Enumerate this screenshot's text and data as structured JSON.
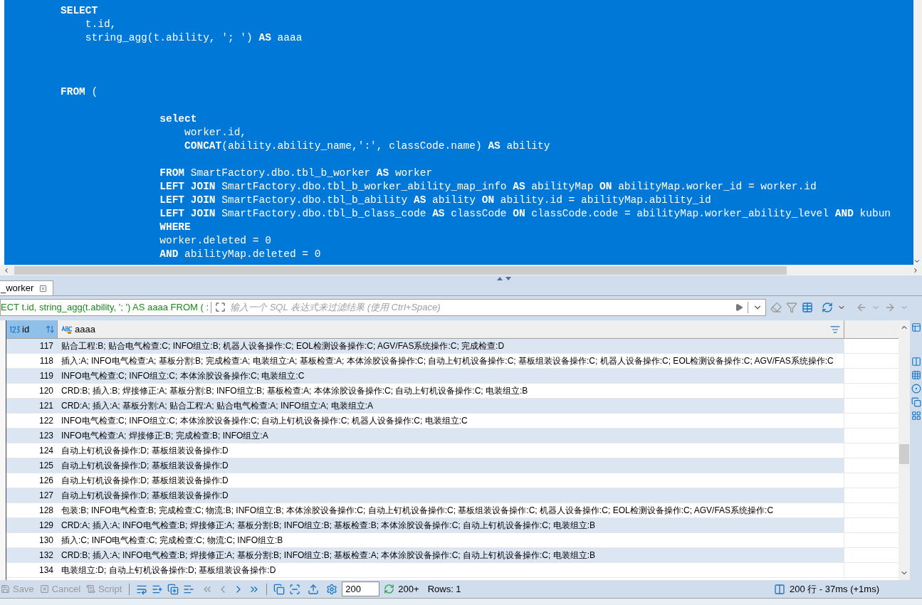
{
  "editor": {
    "lines": [
      {
        "kind": "code",
        "text": "**SELECT**"
      },
      {
        "kind": "code",
        "text": "    t.id,"
      },
      {
        "kind": "code",
        "text": "    string_agg(t.ability, '; ') **AS** aaaa"
      },
      {
        "kind": "blank"
      },
      {
        "kind": "blank"
      },
      {
        "kind": "blank"
      },
      {
        "kind": "code",
        "text": "**FROM** ("
      },
      {
        "kind": "blank"
      },
      {
        "kind": "code",
        "text": "                **select**"
      },
      {
        "kind": "code",
        "text": "                    worker.id,"
      },
      {
        "kind": "code",
        "text": "                    **CONCAT**(ability.ability_name,':', classCode.name) **AS** ability"
      },
      {
        "kind": "blank"
      },
      {
        "kind": "code",
        "text": "                **FROM** SmartFactory.dbo.tbl_b_worker **AS** worker"
      },
      {
        "kind": "code",
        "text": "                **LEFT JOIN** SmartFactory.dbo.tbl_b_worker_ability_map_info **AS** abilityMap **ON** abilityMap.worker_id = worker.id"
      },
      {
        "kind": "code",
        "text": "                **LEFT JOIN** SmartFactory.dbo.tbl_b_ability **AS** ability **ON** ability.id = abilityMap.ability_id"
      },
      {
        "kind": "code",
        "text": "                **LEFT JOIN** SmartFactory.dbo.tbl_b_class_code **AS** classCode **ON** classCode.code = abilityMap.worker_ability_level **AND** kubun"
      },
      {
        "kind": "code",
        "text": "                **WHERE**"
      },
      {
        "kind": "code",
        "text": "                worker.deleted = 0"
      },
      {
        "kind": "code",
        "text": "                **AND** abilityMap.deleted = 0"
      }
    ]
  },
  "results_tab": {
    "label": "_worker",
    "selected": true
  },
  "filter": {
    "query": "ECT t.id, string_agg(t.ability, '; ') AS aaaa FROM ( :",
    "placeholder": "输入一个 SQL 表达式来过滤结果 (使用 Ctrl+Space)"
  },
  "grid": {
    "columns": [
      {
        "name": "id",
        "kind": "number",
        "selected": true
      },
      {
        "name": "aaaa",
        "kind": "text",
        "selected": false
      }
    ],
    "rows": [
      {
        "id": "117",
        "aaaa": "贴合工程:B; 贴合电气检查:C; INFO组立:B; 机器人设备操作:C; EOL检测设备操作:C; AGV/FAS系统操作:C; 完成检查:D"
      },
      {
        "id": "118",
        "aaaa": "插入:A; INFO电气检查:A; 基板分割:B; 完成检查:A; 电装组立:A; 基板检查:A; 本体涂胶设备操作:C; 自动上钉机设备操作:C; 基板组装设备操作:C; 机器人设备操作:C; EOL检测设备操作:C; AGV/FAS系统操作:C"
      },
      {
        "id": "119",
        "aaaa": "INFO电气检查:C; INFO组立:C; 本体涂胶设备操作:C; 电装组立:C"
      },
      {
        "id": "120",
        "aaaa": "CRD:B; 插入:B; 焊接修正:A; 基板分割:B; INFO组立:B; 基板检查:A; 本体涂胶设备操作:C; 自动上钉机设备操作:C; 电装组立:B"
      },
      {
        "id": "121",
        "aaaa": "CRD:A; 插入:A; 基板分割:A; 贴合工程:A; 贴合电气检查:A; INFO组立:A; 电装组立:A"
      },
      {
        "id": "122",
        "aaaa": "INFO电气检查:C; INFO组立:C; 本体涂胶设备操作:C; 自动上钉机设备操作:C; 机器人设备操作:C; 电装组立:C"
      },
      {
        "id": "123",
        "aaaa": "INFO电气检查:A; 焊接修正:B; 完成检查:B; INFO组立:A"
      },
      {
        "id": "124",
        "aaaa": "自动上钉机设备操作:D; 基板组装设备操作:D"
      },
      {
        "id": "125",
        "aaaa": "自动上钉机设备操作:D; 基板组装设备操作:D"
      },
      {
        "id": "126",
        "aaaa": "自动上钉机设备操作:D; 基板组装设备操作:D"
      },
      {
        "id": "127",
        "aaaa": "自动上钉机设备操作:D; 基板组装设备操作:D"
      },
      {
        "id": "128",
        "aaaa": "包装:B; INFO电气检查:B; 完成检查:C; 物流:B; INFO组立:B; 本体涂胶设备操作:C; 自动上钉机设备操作:C; 基板组装设备操作:C; 机器人设备操作:C; EOL检测设备操作:C; AGV/FAS系统操作:C"
      },
      {
        "id": "129",
        "aaaa": "CRD:A; 插入:A; INFO电气检查:B; 焊接修正:A; 基板分割:B; INFO组立:B; 基板检查:B; 本体涂胶设备操作:C; 自动上钉机设备操作:C; 电装组立:B"
      },
      {
        "id": "130",
        "aaaa": "插入:C; INFO电气检查:C; 完成检查:C; 物流:C; INFO组立:B"
      },
      {
        "id": "132",
        "aaaa": "CRD:B; 插入:A; INFO电气检查:B; 焊接修正:A; 基板分割:B; INFO组立:B; 基板检查:A; 本体涂胶设备操作:C; 自动上钉机设备操作:C; 电装组立:B"
      },
      {
        "id": "134",
        "aaaa": "电装组立:D; 自动上钉机设备操作:D; 基板组装设备操作:D"
      }
    ]
  },
  "toolbar": {
    "buttons": [
      {
        "kind": "save",
        "label": "Save",
        "disabled": true
      },
      {
        "kind": "cancel",
        "label": "Cancel",
        "disabled": true
      },
      {
        "kind": "script",
        "label": "Script",
        "disabled": true
      }
    ],
    "fetch_size": "200",
    "fetch_more": "200+",
    "rows_label": "Rows: 1",
    "status": "200 行 - 37ms (+1ms)"
  }
}
